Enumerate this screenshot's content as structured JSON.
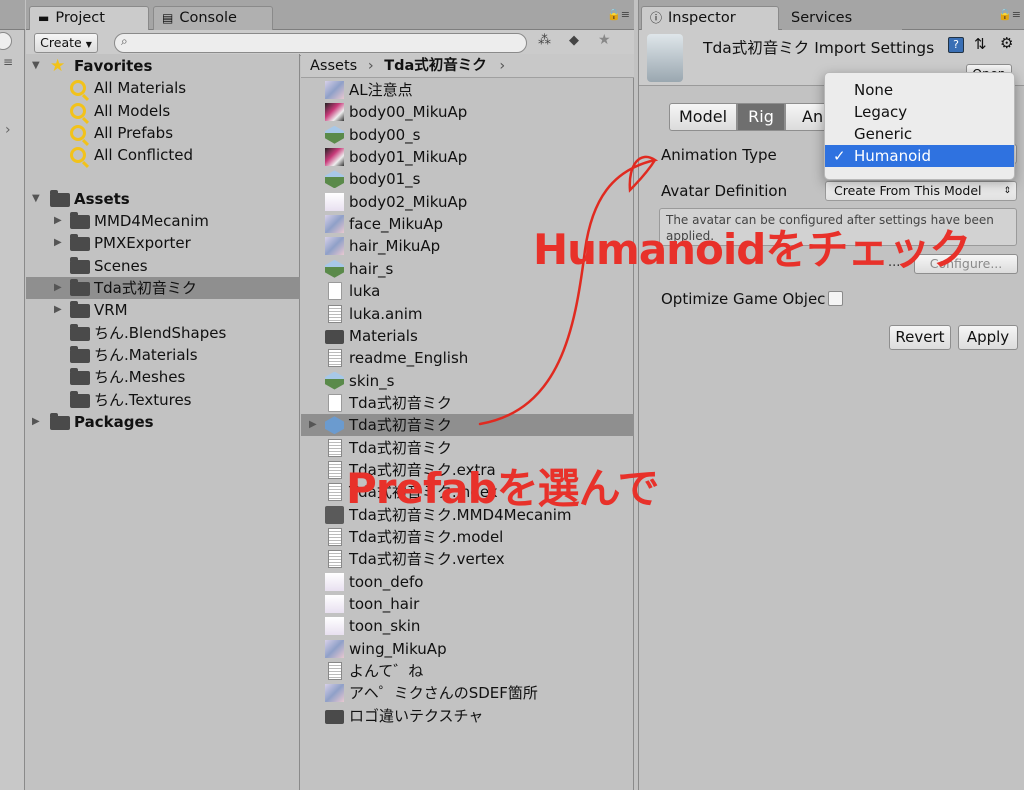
{
  "tabs": {
    "project": "Project",
    "console": "Console",
    "inspector": "Inspector",
    "services": "Services"
  },
  "toolbar": {
    "create_label": "Create",
    "search_placeholder": ""
  },
  "tree": {
    "favorites_label": "Favorites",
    "favorites": [
      "All Materials",
      "All Models",
      "All Prefabs",
      "All Conflicted"
    ],
    "assets_label": "Assets",
    "assets_children": [
      "MMD4Mecanim",
      "PMXExporter",
      "Scenes",
      "Tda式初音ミク",
      "VRM",
      "ちん.BlendShapes",
      "ちん.Materials",
      "ちん.Meshes",
      "ちん.Textures"
    ],
    "packages_label": "Packages"
  },
  "breadcrumb": {
    "root": "Assets",
    "current": "Tda式初音ミク"
  },
  "files": [
    {
      "label": "AL注意点",
      "icon": "texture-icon"
    },
    {
      "label": "body00_MikuAp",
      "icon": "texture-icon"
    },
    {
      "label": "body00_s",
      "icon": "mesh-icon"
    },
    {
      "label": "body01_MikuAp",
      "icon": "texture-icon"
    },
    {
      "label": "body01_s",
      "icon": "mesh-icon"
    },
    {
      "label": "body02_MikuAp",
      "icon": "texture-icon"
    },
    {
      "label": "face_MikuAp",
      "icon": "texture-icon"
    },
    {
      "label": "hair_MikuAp",
      "icon": "texture-icon"
    },
    {
      "label": "hair_s",
      "icon": "mesh-icon"
    },
    {
      "label": "luka",
      "icon": "file-icon"
    },
    {
      "label": "luka.anim",
      "icon": "doc-icon"
    },
    {
      "label": "Materials",
      "icon": "folder-icon"
    },
    {
      "label": "readme_English",
      "icon": "doc-icon"
    },
    {
      "label": "skin_s",
      "icon": "mesh-icon"
    },
    {
      "label": "Tda式初音ミク",
      "icon": "file-icon"
    },
    {
      "label": "Tda式初音ミク",
      "icon": "prefab-icon"
    },
    {
      "label": "Tda式初音ミク",
      "icon": "doc-icon"
    },
    {
      "label": "Tda式初音ミク.extra",
      "icon": "doc-icon"
    },
    {
      "label": "Tda式初音ミク.index",
      "icon": "doc-icon"
    },
    {
      "label": "Tda式初音ミク.MMD4Mecanim",
      "icon": "unity-icon"
    },
    {
      "label": "Tda式初音ミク.model",
      "icon": "doc-icon"
    },
    {
      "label": "Tda式初音ミク.vertex",
      "icon": "doc-icon"
    },
    {
      "label": "toon_defo",
      "icon": "texture-icon"
    },
    {
      "label": "toon_hair",
      "icon": "texture-icon"
    },
    {
      "label": "toon_skin",
      "icon": "texture-icon"
    },
    {
      "label": "wing_MikuAp",
      "icon": "texture-icon"
    },
    {
      "label": "よんて゛ね",
      "icon": "doc-icon"
    },
    {
      "label": "アヘ゜ミクさんのSDEF箇所",
      "icon": "texture-icon"
    },
    {
      "label": "ロゴ違いテクスチャ",
      "icon": "folder-icon"
    }
  ],
  "inspector": {
    "title": "Tda式初音ミク Import Settings",
    "open_button": "Open",
    "tabs": [
      "Model",
      "Rig",
      "An"
    ],
    "animation_type_label": "Animation Type",
    "avatar_definition_label": "Avatar Definition",
    "avatar_definition_value": "Create From This Model",
    "help_text": "The avatar can be configured after settings have been applied.",
    "ellipsis": "...",
    "configure_button": "Configure...",
    "optimize_label": "Optimize Game Objec",
    "revert_button": "Revert",
    "apply_button": "Apply"
  },
  "menu": {
    "items": [
      "None",
      "Legacy",
      "Generic",
      "Humanoid"
    ],
    "selected": "Humanoid",
    "check": "✓"
  },
  "annotations": {
    "humanoid_note": "Humanoidをチェック",
    "prefab_note": "Prefabを選んで"
  },
  "colors": {
    "selection": "#2f72e0",
    "annotation": "#e8312a",
    "favorite_star": "#f2c21a"
  }
}
